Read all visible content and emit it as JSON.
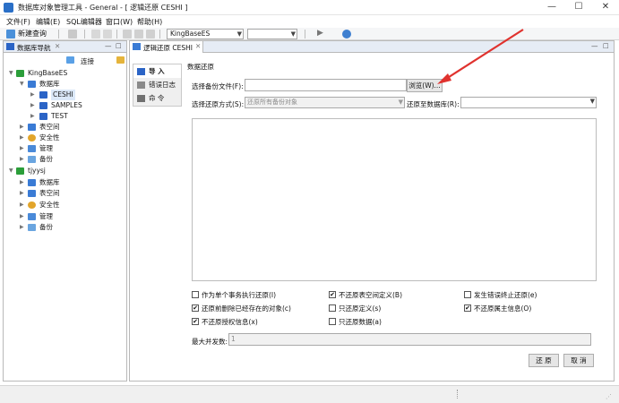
{
  "window": {
    "title": "数据库对象管理工具 - General - [ 逻辑还原 CESHI ]",
    "minimize": "—",
    "maximize": "☐",
    "close": "✕"
  },
  "menu": [
    "文件(F)",
    "编辑(E)",
    "SQL编辑器",
    "窗口(W)",
    "帮助(H)"
  ],
  "toolbar": {
    "new_query": "新建查询",
    "db_combo": "KingBaseES"
  },
  "nav": {
    "tab_label": "数据库导航",
    "connect_label": "连接",
    "tree": [
      {
        "label": "KingBaseES",
        "icon": "server-icon"
      },
      {
        "label": "数据库",
        "icon": "database-folder-icon"
      },
      {
        "label": "CESHI",
        "icon": "database-icon",
        "selected": true
      },
      {
        "label": "SAMPLES",
        "icon": "database-icon"
      },
      {
        "label": "TEST",
        "icon": "database-icon"
      },
      {
        "label": "表空间",
        "icon": "tablespace-icon"
      },
      {
        "label": "安全性",
        "icon": "security-icon"
      },
      {
        "label": "管理",
        "icon": "manage-icon"
      },
      {
        "label": "备份",
        "icon": "backup-icon"
      },
      {
        "label": "tjyysj",
        "icon": "server-icon"
      },
      {
        "label": "数据库",
        "icon": "database-folder-icon"
      },
      {
        "label": "表空间",
        "icon": "tablespace-icon"
      },
      {
        "label": "安全性",
        "icon": "security-icon"
      },
      {
        "label": "管理",
        "icon": "manage-icon"
      },
      {
        "label": "备份",
        "icon": "backup-icon"
      }
    ]
  },
  "editor": {
    "tab_label": "逻辑还原 CESHI",
    "side_tabs": [
      "导 入",
      "错误日志",
      "命 令"
    ],
    "section_title": "数据还原",
    "backup_file_label": "选择备份文件(F):",
    "backup_file_value": "",
    "browse_button": "浏览(W)...",
    "restore_mode_label": "选择还原方式(S):",
    "restore_mode_value": "还原所有备份对象",
    "restore_to_db_label": "还原至数据库(R):",
    "restore_to_db_value": "",
    "options": [
      {
        "label": "作为单个事务执行还原(I)",
        "checked": false
      },
      {
        "label": "不还原表空间定义(B)",
        "checked": true
      },
      {
        "label": "发生错误终止还原(e)",
        "checked": false
      },
      {
        "label": "还原前删除已经存在的对象(c)",
        "checked": true
      },
      {
        "label": "只还原定义(s)",
        "checked": false
      },
      {
        "label": "不还原属主信息(O)",
        "checked": true
      },
      {
        "label": "不还原授权信息(x)",
        "checked": true
      },
      {
        "label": "只还原数据(a)",
        "checked": false
      }
    ],
    "max_concurrency_label": "最大并发数:",
    "max_concurrency_value": "1",
    "restore_button": "还 原",
    "cancel_button": "取 消"
  },
  "colors": {
    "accent_red": "#e0322e",
    "tab_blue": "#e6ecf5",
    "db_blue": "#2b64c6"
  }
}
